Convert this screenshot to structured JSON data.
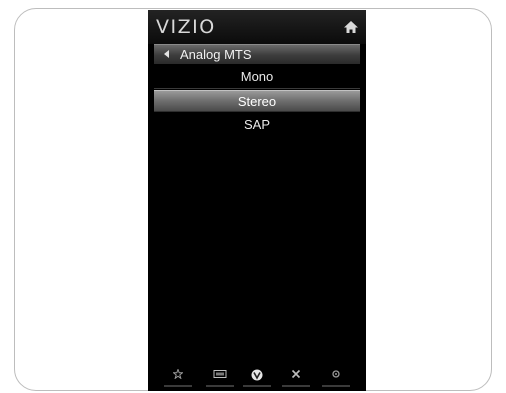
{
  "tv": {
    "brand": "VIZIO",
    "menu_title": "Analog MTS",
    "options": [
      {
        "label": "Mono",
        "selected": false
      },
      {
        "label": "Stereo",
        "selected": true
      },
      {
        "label": "SAP",
        "selected": false
      }
    ],
    "icons": {
      "home": "home-icon",
      "back": "back-arrow-icon",
      "buttons": [
        "star-icon",
        "widescreen-icon",
        "vizio-v-icon",
        "close-icon",
        "settings-icon"
      ]
    },
    "colors": {
      "panel_background": "#000000",
      "selected_highlight": "#8a8a8a",
      "text": "#eaeaea"
    }
  }
}
